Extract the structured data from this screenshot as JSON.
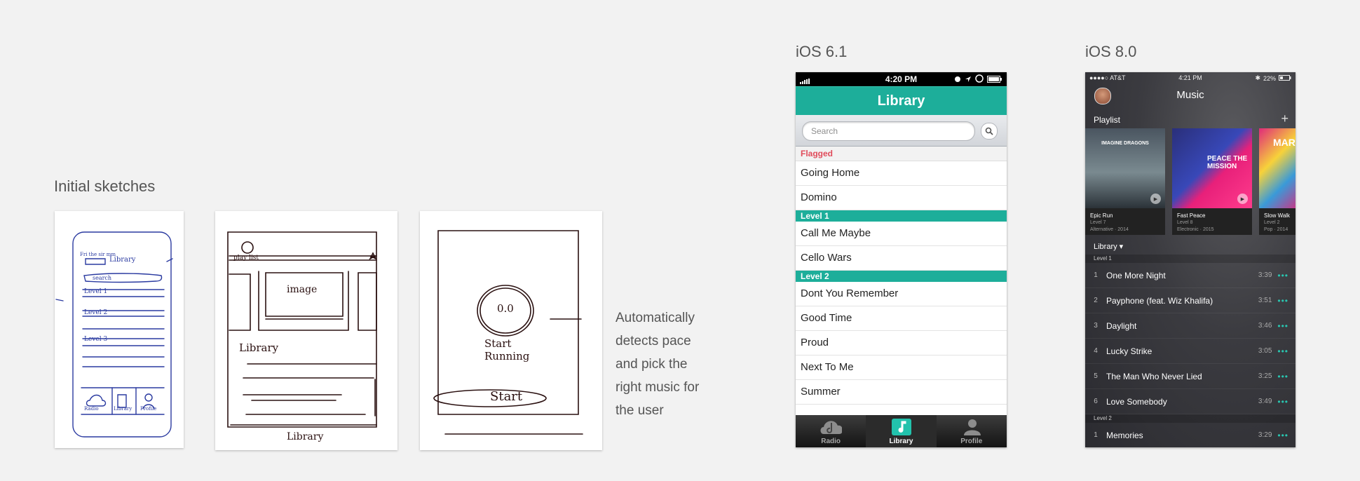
{
  "sections": {
    "sketches_title": "Initial sketches",
    "ios6_title": "iOS 6.1",
    "ios8_title": "iOS 8.0"
  },
  "sketch_note": "Automatically\ndetects pace\nand pick the\nright music for\nthe user",
  "sketches": {
    "s1": {
      "line1": "Library",
      "search": "search",
      "level1": "Level 1",
      "level2": "Level 2",
      "level3": "Level 3",
      "tab1": "Radio",
      "tab2": "Library",
      "tab3": "Profile"
    },
    "s2": {
      "playlist": "play list",
      "image": "image",
      "library": "Library",
      "caption": "Library"
    },
    "s3": {
      "pace": "0.0",
      "start_running": "Start\nRunning",
      "start": "Start"
    }
  },
  "ios6": {
    "status": {
      "time": "4:20 PM"
    },
    "nav_title": "Library",
    "search_placeholder": "Search",
    "flagged_label": "Flagged",
    "flagged": [
      "Going Home",
      "Domino"
    ],
    "level1_label": "Level 1",
    "level1": [
      "Call Me Maybe",
      "Cello Wars"
    ],
    "level2_label": "Level 2",
    "level2": [
      "Dont You Remember",
      "Good Time",
      "Proud",
      "Next To Me",
      "Summer"
    ],
    "tabs": [
      {
        "label": "Radio",
        "icon": "radio-icon"
      },
      {
        "label": "Library",
        "icon": "music-note-icon"
      },
      {
        "label": "Profile",
        "icon": "person-icon"
      }
    ],
    "colors": {
      "accent": "#1dae9a",
      "flagged": "#e04b5a"
    }
  },
  "ios8": {
    "status": {
      "carrier": "●●●●○ AT&T",
      "time": "4:21 PM",
      "battery": "22%"
    },
    "title": "Music",
    "playlist_label": "Playlist",
    "add": "+",
    "albums": [
      {
        "art_text": "IMAGINE DRAGONS",
        "name": "Epic Run",
        "level": "Level 7",
        "meta": "Alternative · 2014"
      },
      {
        "art_text": "PEACE THE MISSION",
        "name": "Fast Peace",
        "level": "Level 8",
        "meta": "Electronic · 2015"
      },
      {
        "art_text": "MARO",
        "name": "Slow Walk",
        "level": "Level 2",
        "meta": "Pop · 2014"
      }
    ],
    "library_dropdown": "Library ▾",
    "level1_label": "Level 1",
    "level1_songs": [
      {
        "num": "1",
        "name": "One More Night",
        "dur": "3:39"
      },
      {
        "num": "2",
        "name": "Payphone (feat. Wiz Khalifa)",
        "dur": "3:51"
      },
      {
        "num": "3",
        "name": "Daylight",
        "dur": "3:46"
      },
      {
        "num": "4",
        "name": "Lucky Strike",
        "dur": "3:05"
      },
      {
        "num": "5",
        "name": "The Man Who Never Lied",
        "dur": "3:25"
      },
      {
        "num": "6",
        "name": "Love Somebody",
        "dur": "3:49"
      }
    ],
    "level2_label": "Level 2",
    "level2_songs": [
      {
        "num": "1",
        "name": "Memories",
        "dur": "3:29"
      }
    ],
    "more": "•••",
    "colors": {
      "accent": "#29c6b0"
    }
  }
}
